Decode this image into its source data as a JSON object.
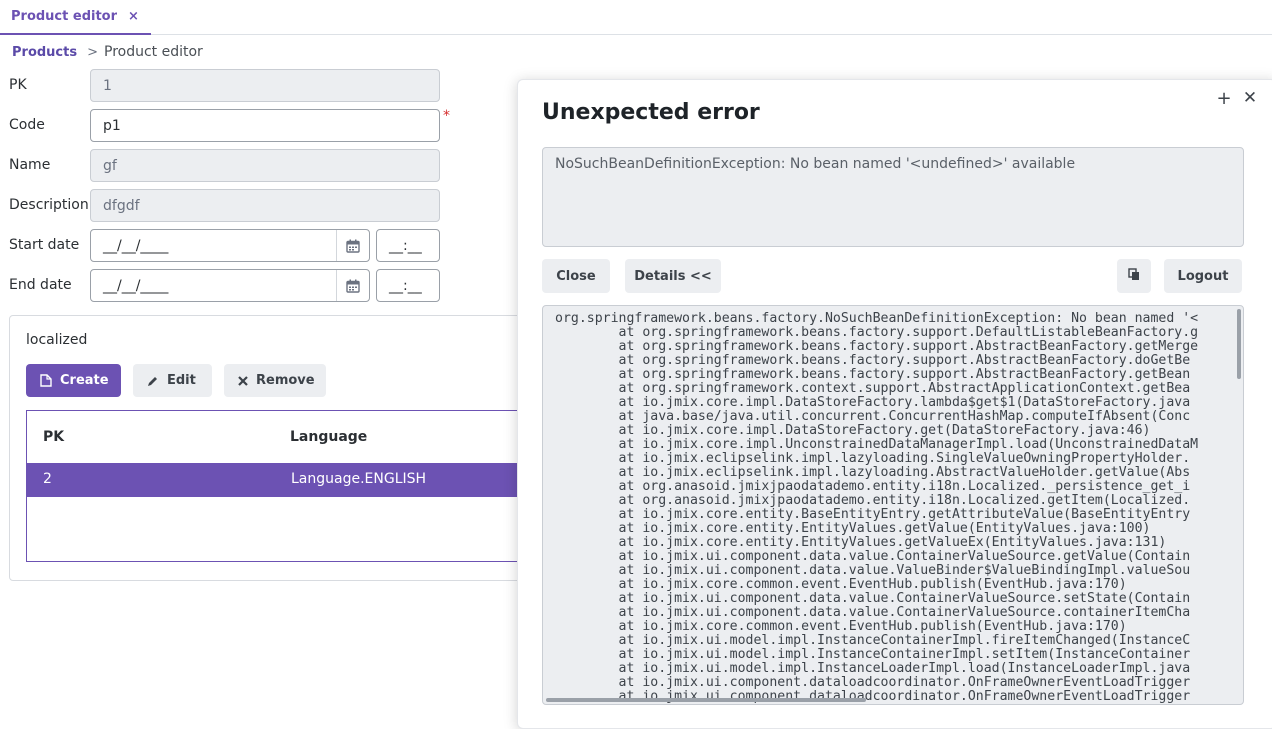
{
  "tab": {
    "label": "Product editor",
    "close": "×"
  },
  "breadcrumb": {
    "parent": "Products",
    "separator": ">",
    "current": "Product editor"
  },
  "form": {
    "pk": {
      "label": "PK",
      "value": "1"
    },
    "code": {
      "label": "Code",
      "value": "p1",
      "required_mark": "*"
    },
    "name": {
      "label": "Name",
      "value": "gf"
    },
    "description": {
      "label": "Description",
      "value": "dfgdf"
    },
    "start_date": {
      "label": "Start date",
      "date": "__/__/____",
      "time": "__:__"
    },
    "end_date": {
      "label": "End date",
      "date": "__/__/____",
      "time": "__:__"
    }
  },
  "localized": {
    "title": "localized",
    "buttons": {
      "create": "Create",
      "edit": "Edit",
      "remove": "Remove"
    },
    "columns": [
      "PK",
      "Language"
    ],
    "rows": [
      {
        "pk": "2",
        "language": "Language.ENGLISH"
      }
    ]
  },
  "dialog": {
    "title": "Unexpected error",
    "message": "NoSuchBeanDefinitionException: No bean named '<undefined>' available",
    "buttons": {
      "close": "Close",
      "details": "Details <<",
      "logout": "Logout"
    },
    "trace": [
      "org.springframework.beans.factory.NoSuchBeanDefinitionException: No bean named '<",
      "\tat org.springframework.beans.factory.support.DefaultListableBeanFactory.g",
      "\tat org.springframework.beans.factory.support.AbstractBeanFactory.getMerge",
      "\tat org.springframework.beans.factory.support.AbstractBeanFactory.doGetBe",
      "\tat org.springframework.beans.factory.support.AbstractBeanFactory.getBean",
      "\tat org.springframework.context.support.AbstractApplicationContext.getBea",
      "\tat io.jmix.core.impl.DataStoreFactory.lambda$get$1(DataStoreFactory.java",
      "\tat java.base/java.util.concurrent.ConcurrentHashMap.computeIfAbsent(Conc",
      "\tat io.jmix.core.impl.DataStoreFactory.get(DataStoreFactory.java:46)",
      "\tat io.jmix.core.impl.UnconstrainedDataManagerImpl.load(UnconstrainedDataM",
      "\tat io.jmix.eclipselink.impl.lazyloading.SingleValueOwningPropertyHolder.",
      "\tat io.jmix.eclipselink.impl.lazyloading.AbstractValueHolder.getValue(Abs",
      "\tat org.anasoid.jmixjpaodatademo.entity.i18n.Localized._persistence_get_i",
      "\tat org.anasoid.jmixjpaodatademo.entity.i18n.Localized.getItem(Localized.",
      "\tat io.jmix.core.entity.BaseEntityEntry.getAttributeValue(BaseEntityEntry",
      "\tat io.jmix.core.entity.EntityValues.getValue(EntityValues.java:100)",
      "\tat io.jmix.core.entity.EntityValues.getValueEx(EntityValues.java:131)",
      "\tat io.jmix.ui.component.data.value.ContainerValueSource.getValue(Contain",
      "\tat io.jmix.ui.component.data.value.ValueBinder$ValueBindingImpl.valueSou",
      "\tat io.jmix.core.common.event.EventHub.publish(EventHub.java:170)",
      "\tat io.jmix.ui.component.data.value.ContainerValueSource.setState(Contain",
      "\tat io.jmix.ui.component.data.value.ContainerValueSource.containerItemCha",
      "\tat io.jmix.core.common.event.EventHub.publish(EventHub.java:170)",
      "\tat io.jmix.ui.model.impl.InstanceContainerImpl.fireItemChanged(InstanceC",
      "\tat io.jmix.ui.model.impl.InstanceContainerImpl.setItem(InstanceContainer",
      "\tat io.jmix.ui.model.impl.InstanceLoaderImpl.load(InstanceLoaderImpl.java",
      "\tat io.jmix.ui.component.dataloadcoordinator.OnFrameOwnerEventLoadTrigger",
      "\tat io.jmix.ui.component.dataloadcoordinator.OnFrameOwnerEventLoadTrigger"
    ]
  },
  "colors": {
    "accent": "#6c52b3",
    "required": "#d62d2d"
  }
}
